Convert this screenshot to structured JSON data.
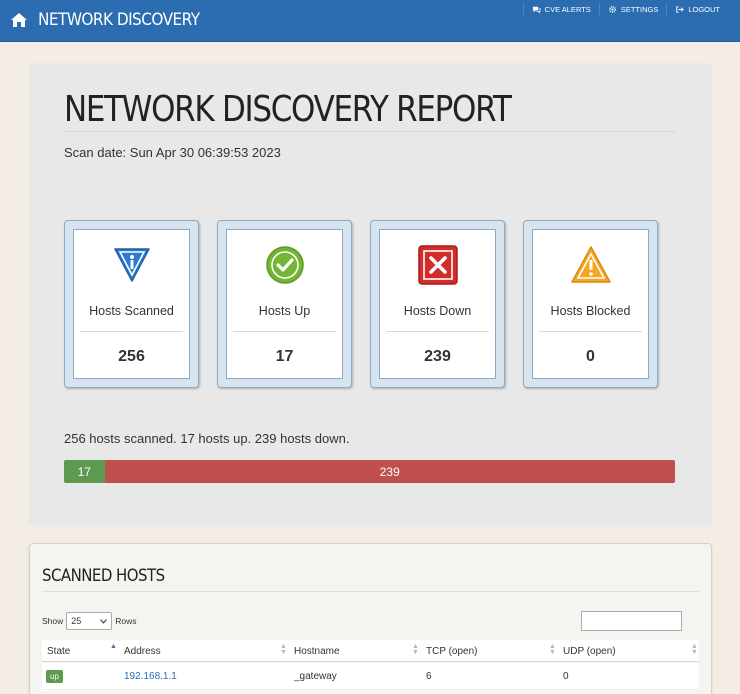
{
  "navbar": {
    "brand": "NETWORK DISCOVERY",
    "links": [
      {
        "label": "CVE ALERTS",
        "icon": "comments-icon"
      },
      {
        "label": "SETTINGS",
        "icon": "gear-icon"
      },
      {
        "label": "LOGOUT",
        "icon": "logout-icon"
      }
    ]
  },
  "report": {
    "title": "NETWORK DISCOVERY REPORT",
    "scan_date": "Scan date: Sun Apr 30 06:39:53 2023",
    "stats": [
      {
        "label": "Hosts Scanned",
        "value": "256",
        "icon": "info-triangle-icon"
      },
      {
        "label": "Hosts Up",
        "value": "17",
        "icon": "check-circle-icon"
      },
      {
        "label": "Hosts Down",
        "value": "239",
        "icon": "x-square-icon"
      },
      {
        "label": "Hosts Blocked",
        "value": "0",
        "icon": "warning-icon"
      }
    ],
    "summary": "256 hosts scanned. 17 hosts up. 239 hosts down.",
    "progress": {
      "up": 17,
      "down": 239,
      "up_label": "17",
      "down_label": "239"
    }
  },
  "hosts": {
    "title": "SCANNED HOSTS",
    "show_label": "Show",
    "rows_label": "Rows",
    "page_length": "25",
    "columns": [
      "State",
      "Address",
      "Hostname",
      "TCP (open)",
      "UDP (open)"
    ],
    "rows": [
      {
        "state": "up",
        "address": "192.168.1.1",
        "hostname": "_gateway",
        "tcp": "6",
        "udp": "0"
      }
    ]
  },
  "colors": {
    "navbar": "#2b6db0",
    "up": "#5c9a4f",
    "down": "#c0504d",
    "background": "#f4ede6"
  }
}
